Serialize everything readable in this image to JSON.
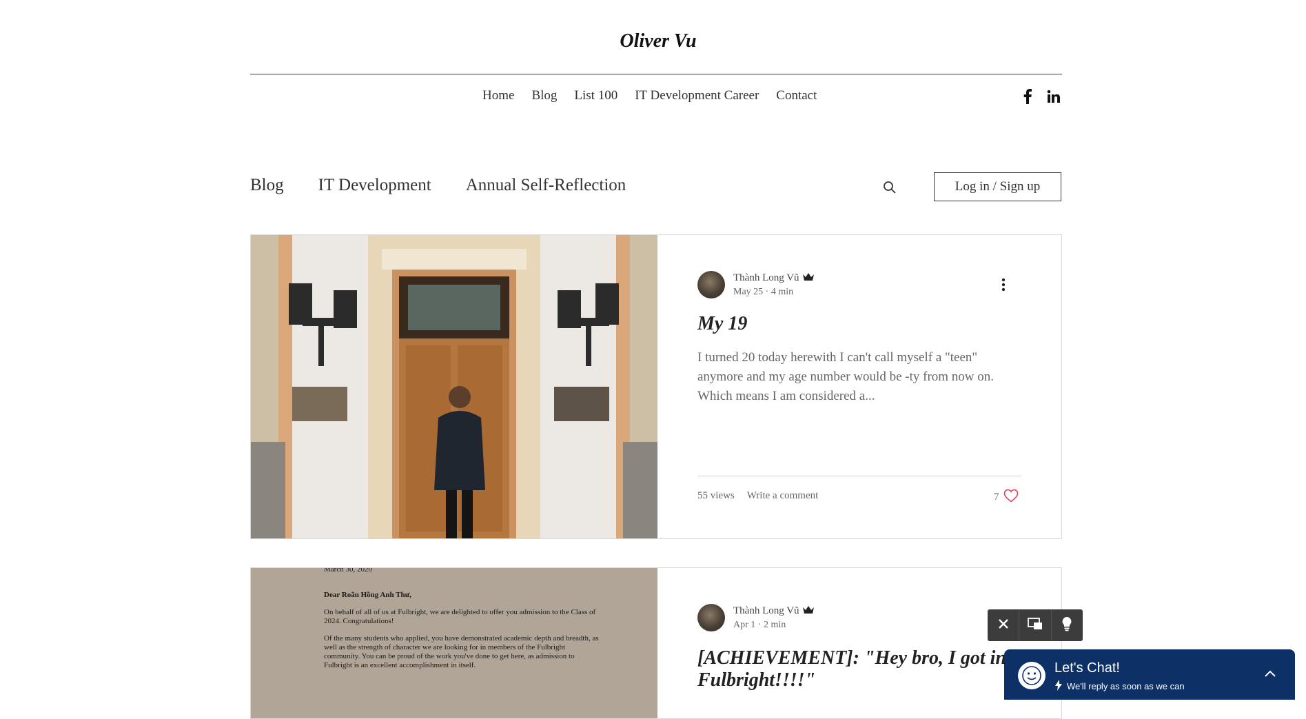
{
  "site": {
    "title": "Oliver Vu"
  },
  "nav": {
    "items": [
      {
        "label": "Home"
      },
      {
        "label": "Blog"
      },
      {
        "label": "List 100"
      },
      {
        "label": "IT Development Career"
      },
      {
        "label": "Contact"
      }
    ],
    "social": [
      "facebook-icon",
      "linkedin-icon"
    ]
  },
  "blog_nav": {
    "categories": [
      {
        "label": "Blog"
      },
      {
        "label": "IT Development"
      },
      {
        "label": "Annual Self-Reflection"
      }
    ],
    "login_label": "Log in / Sign up"
  },
  "posts": [
    {
      "author": "Thành Long Vũ",
      "date": "May 25",
      "read_time": "4 min",
      "title": "My 19",
      "excerpt": "I turned 20 today herewith I can't call myself a \"teen\" anymore and my age number would be -ty from now on. Which means I am considered a...",
      "views": "55 views",
      "comment_label": "Write a comment",
      "likes": "7"
    },
    {
      "author": "Thành Long Vũ",
      "date": "Apr 1",
      "read_time": "2 min",
      "title": "[ACHIEVEMENT]: \"Hey bro, I got into Fulbright!!!!\"",
      "letter": {
        "date": "March 30, 2020",
        "salutation": "Dear Roãn Hồng Anh Thư,",
        "para1": "On behalf of all of us at Fulbright, we are delighted to offer you admission to the Class of 2024. Congratulations!",
        "para2": "Of the many students who applied, you have demonstrated academic depth and breadth, as well as the strength of character we are looking for in members of the Fulbright community. You can be proud of the work you've done to get here, as admission to Fulbright is an excellent accomplishment in itself."
      }
    }
  ],
  "chat": {
    "title": "Let's Chat!",
    "subtitle": "We'll reply as soon as we can"
  },
  "colors": {
    "heart": "#e0435a",
    "chat_bg": "#0d3166",
    "chat_controls_bg": "#3c3c3c"
  }
}
